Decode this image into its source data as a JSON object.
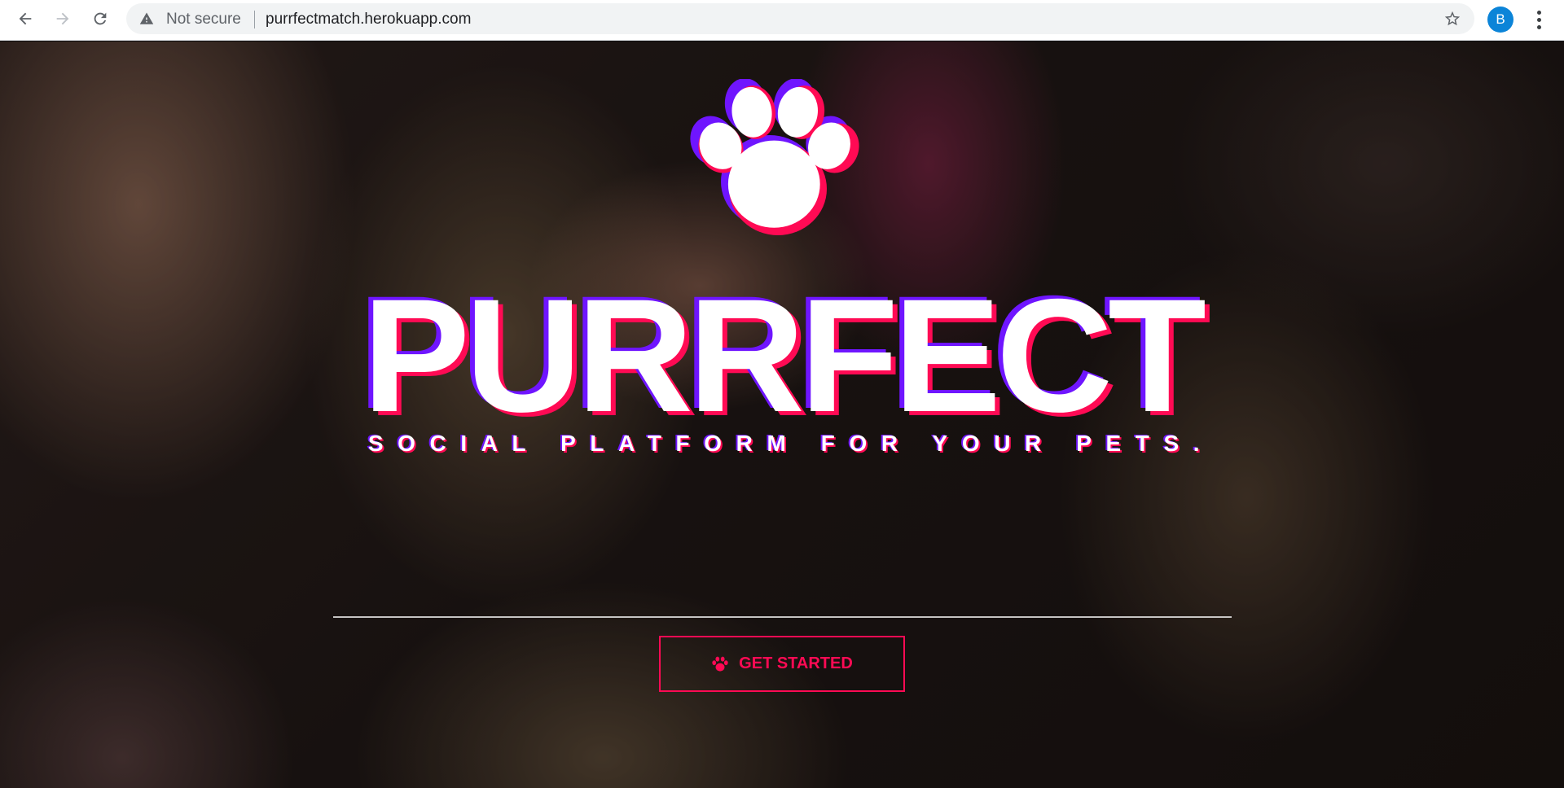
{
  "browser": {
    "security_label": "Not secure",
    "url": "purrfectmatch.herokuapp.com",
    "profile_initial": "B",
    "icons": {
      "back": "arrow-left-icon",
      "forward": "arrow-right-icon",
      "reload": "reload-icon",
      "warning": "warning-triangle-icon",
      "bookmark": "star-outline-icon",
      "menu": "kebab-menu-icon"
    },
    "colors": {
      "profile_avatar": "#0b84d8"
    }
  },
  "hero": {
    "logo_icon": "paw-icon",
    "title": "PURRFECT",
    "tagline": "SOCIAL PLATFORM FOR YOUR PETS.",
    "cta_label": "GET STARTED",
    "cta_icon": "paw-icon",
    "colors": {
      "accent_pink": "#ff0a54",
      "accent_purple": "#6f15ff",
      "text": "#ffffff"
    }
  }
}
